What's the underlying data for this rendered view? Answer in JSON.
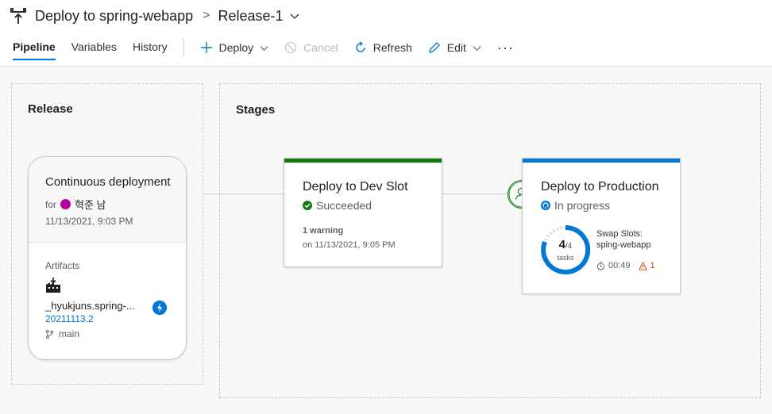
{
  "breadcrumb": {
    "pipeline": "Deploy to spring-webapp",
    "release": "Release-1"
  },
  "tabs": [
    {
      "label": "Pipeline",
      "active": true
    },
    {
      "label": "Variables"
    },
    {
      "label": "History"
    }
  ],
  "toolbar": {
    "deploy": "Deploy",
    "cancel": "Cancel",
    "refresh": "Refresh",
    "edit": "Edit",
    "more": "···"
  },
  "release_panel": {
    "label": "Release",
    "card": {
      "title": "Continuous deployment",
      "for_prefix": "for",
      "user": "혁준 남",
      "date": "11/13/2021, 9:03 PM",
      "artifacts_label": "Artifacts",
      "artifact_name": "_hyukjuns.spring-...",
      "artifact_version": "20211113.2",
      "branch": "main"
    }
  },
  "stages_panel": {
    "label": "Stages",
    "stages": [
      {
        "name": "Deploy to Dev Slot",
        "status": "Succeeded",
        "status_color": "#107c10",
        "warning": "1 warning",
        "date": "on 11/13/2021, 9:05 PM"
      },
      {
        "name": "Deploy to Production",
        "status": "In progress",
        "status_color": "#0078d4",
        "completed_tasks": "4",
        "total_tasks": "/4",
        "tasks_label": "tasks",
        "task_name_line1": "Swap Slots:",
        "task_name_line2": "sping-webapp",
        "duration": "00:49",
        "warnings": "1"
      }
    ]
  },
  "colors": {
    "accent": "#0078d4",
    "success": "#107c10",
    "warning": "#d83b01"
  }
}
